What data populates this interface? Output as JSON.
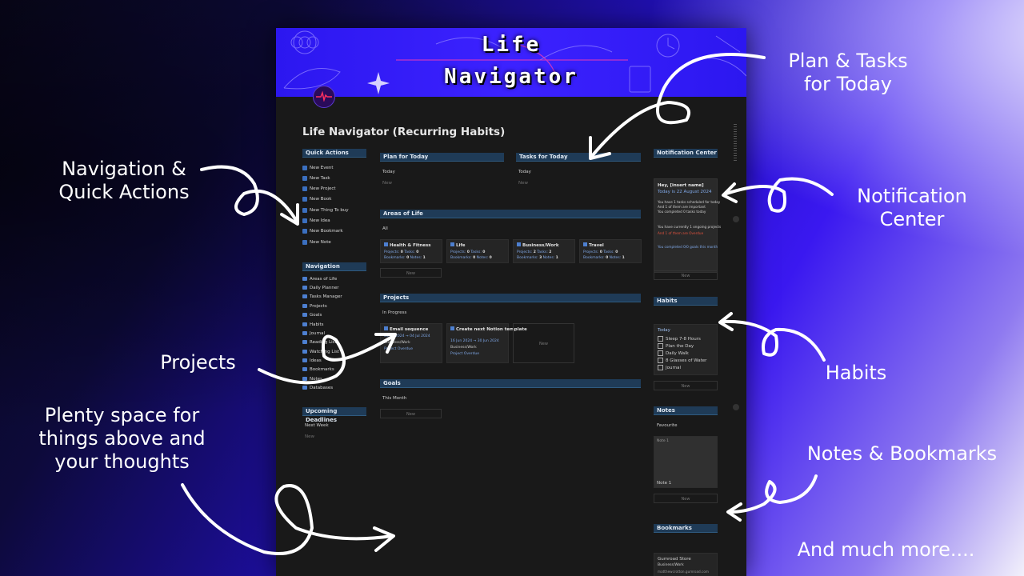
{
  "banner": {
    "line1": "Life",
    "line2": "Navigator"
  },
  "page_title": "Life Navigator (Recurring Habits)",
  "quick_actions": {
    "header": "Quick Actions",
    "buttons": [
      "New Event",
      "New Task",
      "New Project",
      "New Book",
      "New Thing To buy",
      "New Idea",
      "New Bookmark",
      "New Note"
    ]
  },
  "navigation": {
    "header": "Navigation",
    "items": [
      "Areas of Life",
      "Daily Planner",
      "Tasks Manager",
      "Projects",
      "Goals",
      "Habits",
      "Journal",
      "Reading List",
      "Watching List",
      "Ideas",
      "Bookmarks",
      "Notes",
      "Databases"
    ]
  },
  "upcoming": {
    "header": "Upcoming Deadlines",
    "view": "Next Week",
    "new": "New"
  },
  "plan": {
    "header": "Plan for Today",
    "view": "Today",
    "new": "New"
  },
  "tasks": {
    "header": "Tasks for Today",
    "view": "Today",
    "new": "New"
  },
  "areas": {
    "header": "Areas of Life",
    "view": "All",
    "new": "New",
    "cards": [
      {
        "name": "Health & Fitness",
        "projects": "0",
        "tasks": "0",
        "bookmarks": "0",
        "notes": "1"
      },
      {
        "name": "Life",
        "projects": "0",
        "tasks": "0",
        "bookmarks": "0",
        "notes": "0"
      },
      {
        "name": "Business/Work",
        "projects": "2",
        "tasks": "2",
        "bookmarks": "3",
        "notes": "1"
      },
      {
        "name": "Travel",
        "projects": "0",
        "tasks": "0",
        "bookmarks": "0",
        "notes": "1"
      }
    ]
  },
  "projects": {
    "header": "Projects",
    "view": "In Progress",
    "new": "New",
    "cards": [
      {
        "name": "Email sequence",
        "dates": "03 Jul 2024 → 04 Jul 2024",
        "area": "Business/Work",
        "status": "Project Overdue"
      },
      {
        "name": "Create next Notion template",
        "dates": "16 Jun 2024 → 30 Jun 2024",
        "area": "Business/Work",
        "status": "Project Overdue"
      }
    ]
  },
  "goals": {
    "header": "Goals",
    "view": "This Month",
    "new": "New"
  },
  "notification": {
    "header": "Notification Center",
    "greeting": "Hey, [insert name]",
    "today": "Today is 22 August 2024",
    "lines": [
      "You have 1 tasks scheduled for today",
      "And 1 of them are important",
      "You completed 0 tasks today",
      "You have currently 1 ongoing projects",
      "And 1 of them are Overdue",
      "You completed 0/0 goals this month"
    ],
    "new": "New"
  },
  "habits": {
    "header": "Habits",
    "view": "Today",
    "new": "New",
    "items": [
      "Sleep 7-8 Hours",
      "Plan the Day",
      "Daily Walk",
      "8 Glasses of Water",
      "Journal"
    ]
  },
  "notes": {
    "header": "Notes",
    "view": "Favourite",
    "card_top": "Note 1",
    "card_name": "Note 1",
    "new": "New"
  },
  "bookmarks": {
    "header": "Bookmarks",
    "item": "Gumroad Store",
    "area": "Business/Work",
    "url": "matthewcrotton.gumroad.com"
  },
  "annotations": {
    "plan_tasks": [
      "Plan & Tasks",
      "for Today"
    ],
    "nav_quick": [
      "Navigation &",
      "Quick Actions"
    ],
    "notification": [
      "Notification",
      "Center"
    ],
    "projects": "Projects",
    "habits": "Habits",
    "space": [
      "Plenty space for",
      "things above and",
      "your thoughts"
    ],
    "notes_bookmarks": "Notes & Bookmarks",
    "more": "And much more...."
  }
}
